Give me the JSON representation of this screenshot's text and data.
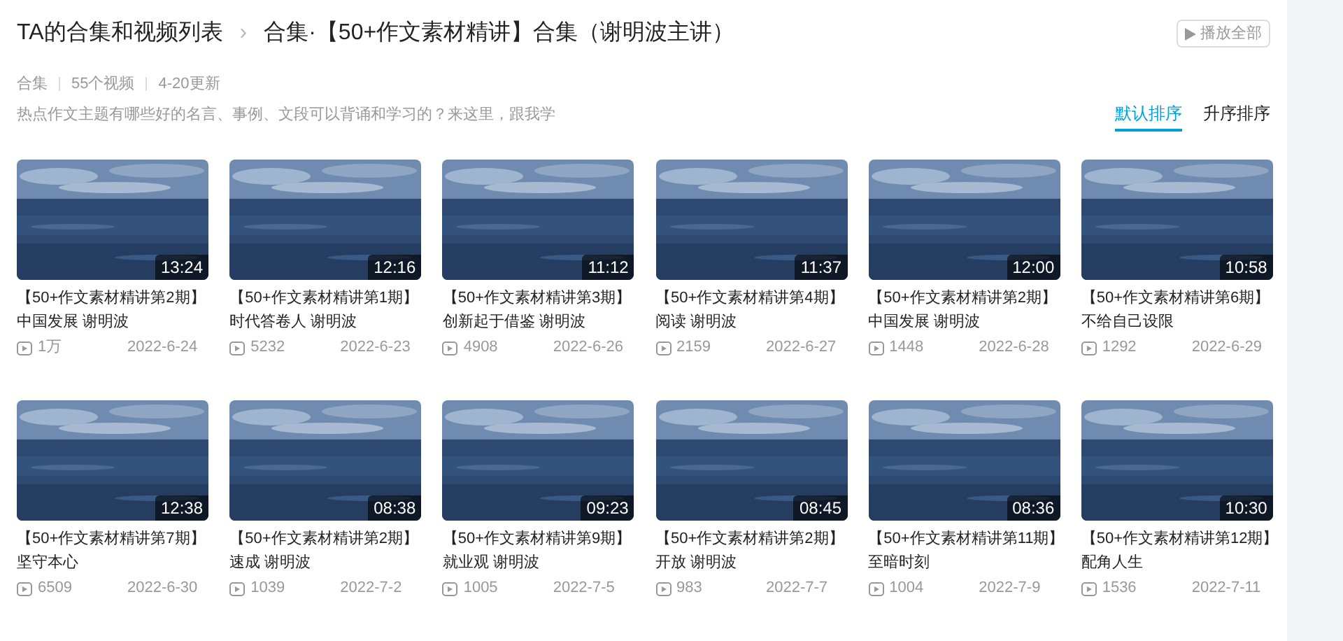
{
  "breadcrumb": {
    "parent": "TA的合集和视频列表",
    "separator": "›",
    "current": "合集·【50+作文素材精讲】合集（谢明波主讲）"
  },
  "play_all_button": "播放全部",
  "meta": [
    "合集",
    "55个视频",
    "4-20更新"
  ],
  "description": "热点作文主题有哪些好的名言、事例、文段可以背诵和学习的？来这里，跟我学",
  "sort_tabs": [
    {
      "label": "默认排序",
      "selected": true
    },
    {
      "label": "升序排序",
      "selected": false
    }
  ],
  "videos": [
    {
      "duration": "13:24",
      "title": "【50+作文素材精讲第2期】",
      "subtitle": "中国发展 谢明波",
      "plays": "1万",
      "date": "2022-6-24"
    },
    {
      "duration": "12:16",
      "title": "【50+作文素材精讲第1期】",
      "subtitle": "时代答卷人 谢明波",
      "plays": "5232",
      "date": "2022-6-23"
    },
    {
      "duration": "11:12",
      "title": "【50+作文素材精讲第3期】",
      "subtitle": "创新起于借鉴 谢明波",
      "plays": "4908",
      "date": "2022-6-26"
    },
    {
      "duration": "11:37",
      "title": "【50+作文素材精讲第4期】",
      "subtitle": "阅读 谢明波",
      "plays": "2159",
      "date": "2022-6-27"
    },
    {
      "duration": "12:00",
      "title": "【50+作文素材精讲第2期】",
      "subtitle": "中国发展 谢明波",
      "plays": "1448",
      "date": "2022-6-28"
    },
    {
      "duration": "10:58",
      "title": "【50+作文素材精讲第6期】",
      "subtitle": "不给自己设限",
      "plays": "1292",
      "date": "2022-6-29"
    },
    {
      "duration": "12:38",
      "title": "【50+作文素材精讲第7期】",
      "subtitle": "坚守本心",
      "plays": "6509",
      "date": "2022-6-30"
    },
    {
      "duration": "08:38",
      "title": "【50+作文素材精讲第2期】",
      "subtitle": "速成 谢明波",
      "plays": "1039",
      "date": "2022-7-2"
    },
    {
      "duration": "09:23",
      "title": "【50+作文素材精讲第9期】",
      "subtitle": "就业观 谢明波",
      "plays": "1005",
      "date": "2022-7-5"
    },
    {
      "duration": "08:45",
      "title": "【50+作文素材精讲第2期】",
      "subtitle": "开放 谢明波",
      "plays": "983",
      "date": "2022-7-7"
    },
    {
      "duration": "08:36",
      "title": "【50+作文素材精讲第11期】",
      "subtitle": "至暗时刻",
      "plays": "1004",
      "date": "2022-7-9"
    },
    {
      "duration": "10:30",
      "title": "【50+作文素材精讲第12期】",
      "subtitle": "配角人生",
      "plays": "1536",
      "date": "2022-7-11"
    }
  ]
}
